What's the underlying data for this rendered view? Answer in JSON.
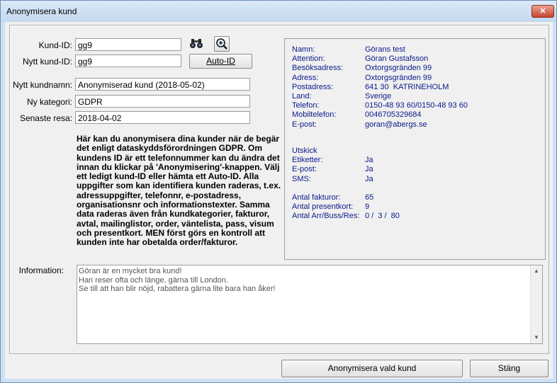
{
  "window": {
    "title": "Anonymisera kund",
    "close_symbol": "✕"
  },
  "form": {
    "kundid_label": "Kund-ID:",
    "kundid_value": "gg9",
    "nytt_kundid_label": "Nytt kund-ID:",
    "nytt_kundid_value": "gg9",
    "autoid_label": "Auto-ID",
    "nytt_kundnamn_label": "Nytt kundnamn:",
    "nytt_kundnamn_value": "Anonymiserad kund (2018-05-02)",
    "ny_kategori_label": "Ny kategori:",
    "ny_kategori_value": "GDPR",
    "senaste_resa_label": "Senaste resa:",
    "senaste_resa_value": "2018-04-02",
    "description": "Här kan du anonymisera dina kunder när de begär det enligt dataskyddsförordningen GDPR. Om kundens ID är ett telefonnummer kan du ändra det innan du klickar på 'Anonymisering'-knappen. Välj ett ledigt kund-ID eller hämta ett Auto-ID. Alla uppgifter som kan identifiera kunden raderas, t.ex. adressuppgifter, telefonnr, e-postadress, organisationsnr och informationstexter. Samma data raderas även från kundkategorier, fakturor, avtal, mailinglistor, order, väntelista, pass, visum och presentkort. MEN först görs en kontroll att kunden inte har obetalda order/fakturor.",
    "information_label": "Information:",
    "information_text": "Göran är en mycket bra kund!\nHan reser ofta och länge, gärna till London.\nSe till att han blir nöjd, rabattera gärna lite bara han åker!"
  },
  "customer_info": {
    "rows": [
      {
        "label": "Namn:",
        "value": "Görans test"
      },
      {
        "label": "Attention:",
        "value": "Göran Gustafsson"
      },
      {
        "label": "Besöksadress:",
        "value": "Oxtorgsgränden 99"
      },
      {
        "label": "Adress:",
        "value": "Oxtorgsgränden 99"
      },
      {
        "label": "Postadress:",
        "value": "641 30  KATRINEHOLM"
      },
      {
        "label": "Land:",
        "value": "Sverige"
      },
      {
        "label": "Telefon:",
        "value": "0150-48 93 60/0150-48 93 60"
      },
      {
        "label": "Mobiltelefon:",
        "value": "0046705329684"
      },
      {
        "label": "E-post:",
        "value": "goran@abergs.se"
      }
    ],
    "utskick_header": "Utskick",
    "utskick": [
      {
        "label": "Etiketter:",
        "value": "Ja"
      },
      {
        "label": "E-post:",
        "value": "Ja"
      },
      {
        "label": "SMS:",
        "value": "Ja"
      }
    ],
    "stats": [
      {
        "label": "Antal fakturor:",
        "value": "65"
      },
      {
        "label": "Antal presentkort:",
        "value": "9"
      },
      {
        "label": "Antal Arr/Buss/Res:",
        "value": "0 /  3 /  80"
      }
    ]
  },
  "buttons": {
    "anonymize_label": "Anonymisera vald kund",
    "close_label": "Stäng"
  },
  "icons": {
    "binoculars": "binoculars-icon",
    "zoom": "magnifier-plus-icon"
  },
  "colors": {
    "info_text": "#0a1a8a",
    "title_bar": "#c3d8f0",
    "close_button": "#c7452f"
  }
}
